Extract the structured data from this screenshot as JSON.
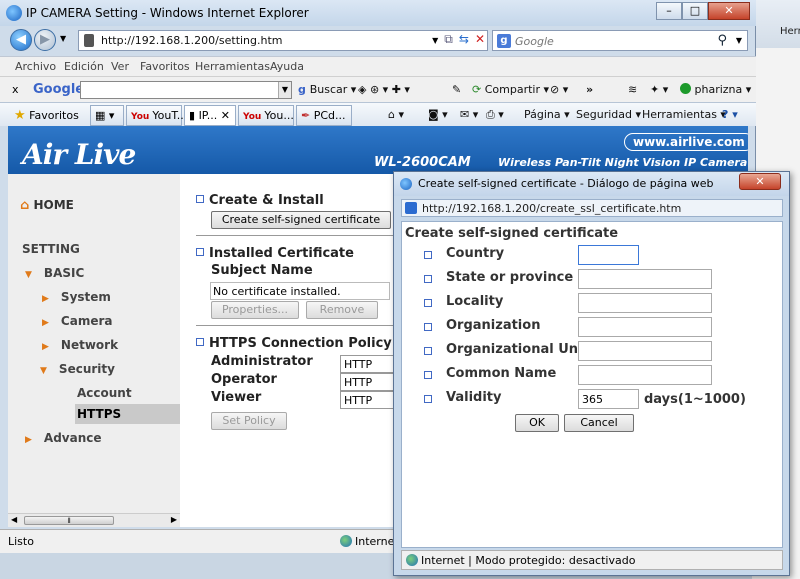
{
  "window": {
    "title": "IP CAMERA Setting - Windows Internet Explorer",
    "address": "http://192.168.1.200/setting.htm",
    "search_placeholder": "Google",
    "bg_hint": "Herr"
  },
  "menu": [
    "Archivo",
    "Edición",
    "Ver",
    "Favoritos",
    "Herramientas",
    "Ayuda"
  ],
  "googlebar": {
    "close": "x",
    "logo": "Google",
    "buscar": "Buscar",
    "compartir": "Compartir",
    "more": "»",
    "user": "pharizna"
  },
  "favbar": {
    "favoritos": "Favoritos",
    "tabs": [
      "YouT...",
      "IP...",
      "You...",
      "PCd..."
    ],
    "pagina": "Página",
    "seguridad": "Seguridad",
    "herramientas": "Herramientas"
  },
  "banner": {
    "logo": "Air Live",
    "site": "www.airlive.com",
    "model": "WL-2600CAM",
    "desc": "Wireless Pan-Tilt Night Vision IP Camera"
  },
  "nav": {
    "home": "HOME",
    "setting": "SETTING",
    "basic": "BASIC",
    "system": "System",
    "camera": "Camera",
    "network": "Network",
    "security": "Security",
    "account": "Account",
    "https": "HTTPS",
    "advance": "Advance"
  },
  "main": {
    "create_install": "Create & Install",
    "create_btn": "Create self-signed certificate",
    "installed_cert": "Installed Certificate",
    "subject_name": "Subject Name",
    "no_cert": "No certificate installed.",
    "properties": "Properties...",
    "remove": "Remove",
    "policy_title": "HTTPS Connection Policy",
    "admin": "Administrator",
    "operator": "Operator",
    "viewer": "Viewer",
    "admin_val": "HTTP",
    "operator_val": "HTTP",
    "viewer_val": "HTTP",
    "set_policy": "Set Policy"
  },
  "status": {
    "text": "Listo",
    "zone": "Internet"
  },
  "dialog": {
    "title": "Create self-signed certificate - Diálogo de página web",
    "address": "http://192.168.1.200/create_ssl_certificate.htm",
    "heading": "Create self-signed certificate",
    "fields": [
      {
        "label": "Country",
        "value": ""
      },
      {
        "label": "State or province",
        "value": ""
      },
      {
        "label": "Locality",
        "value": ""
      },
      {
        "label": "Organization",
        "value": ""
      },
      {
        "label": "Organizational Unit",
        "value": ""
      },
      {
        "label": "Common Name",
        "value": ""
      },
      {
        "label": "Validity",
        "value": "365"
      }
    ],
    "validity_unit": "days(1~1000)",
    "ok": "OK",
    "cancel": "Cancel",
    "status": "Internet | Modo protegido: desactivado"
  }
}
